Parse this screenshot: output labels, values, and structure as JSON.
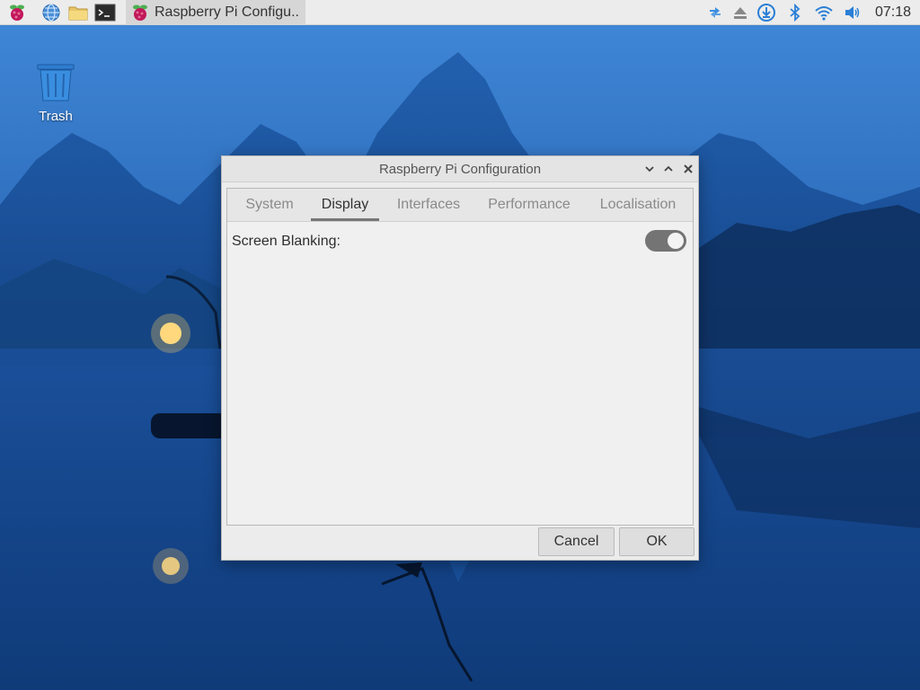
{
  "taskbar": {
    "menu_icon": "raspberry-menu-icon",
    "launchers": [
      "globe-icon",
      "folder-icon",
      "terminal-icon"
    ],
    "task_window_label": "Raspberry Pi Configu..",
    "tray_icons": [
      "network-transfer-icon",
      "eject-icon",
      "download-icon",
      "bluetooth-icon",
      "wifi-icon",
      "volume-icon"
    ],
    "clock": "07:18"
  },
  "desktop": {
    "trash_label": "Trash"
  },
  "window": {
    "title": "Raspberry Pi Configuration",
    "controls": [
      "minimize-icon",
      "maximize-icon",
      "close-icon"
    ],
    "tabs": [
      {
        "label": "System",
        "active": false
      },
      {
        "label": "Display",
        "active": true
      },
      {
        "label": "Interfaces",
        "active": false
      },
      {
        "label": "Performance",
        "active": false
      },
      {
        "label": "Localisation",
        "active": false
      }
    ],
    "display": {
      "screen_blanking_label": "Screen Blanking:",
      "screen_blanking_on": false
    },
    "buttons": {
      "cancel": "Cancel",
      "ok": "OK"
    }
  },
  "colors": {
    "taskbar_bg": "#ececec",
    "accent_blue": "#2a7fd6",
    "toggle_off": "#747474"
  }
}
